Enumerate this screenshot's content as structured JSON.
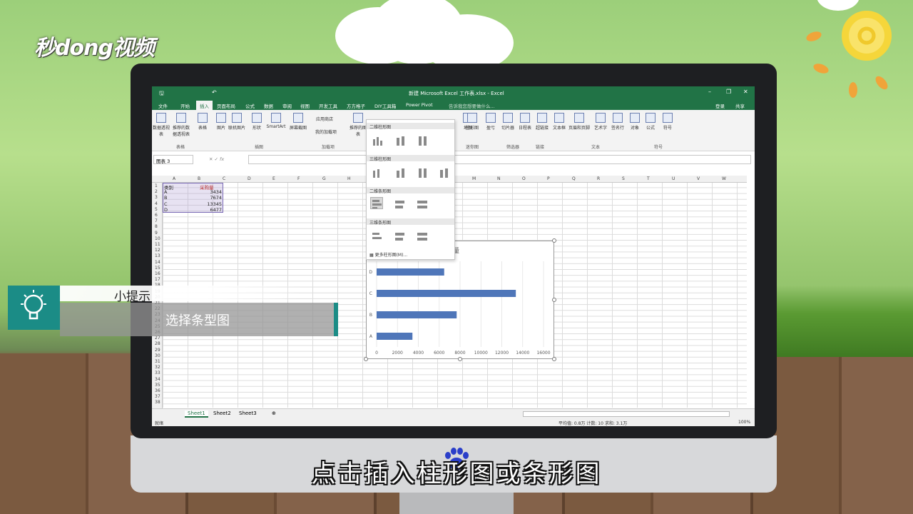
{
  "branding": {
    "logo_text": "秒dong视频"
  },
  "excel": {
    "window_title": "新建 Microsoft Excel 工作表.xlsx - Excel",
    "tabs": [
      "文件",
      "开始",
      "插入",
      "页面布局",
      "公式",
      "数据",
      "审阅",
      "视图",
      "开发工具",
      "方方格子",
      "DIY工具箱",
      "Power Pivot"
    ],
    "active_tab": "插入",
    "tell_me": "告诉我您想要做什么...",
    "login": "登录",
    "share": "共享",
    "ribbon": {
      "buttons": [
        "数据透视表",
        "推荐的数据透视表",
        "表格",
        "图片",
        "联机图片",
        "形状",
        "SmartArt",
        "屏幕截图",
        "应用商店",
        "我的加载项",
        "推荐的图表",
        "地图",
        "柱形图",
        "盈亏",
        "切片器",
        "日程表",
        "超链接",
        "文本框",
        "页眉和页脚",
        "艺术字",
        "签名行",
        "对象",
        "公式",
        "符号"
      ],
      "groups": [
        "表格",
        "插图",
        "加载项",
        "迷你图",
        "筛选器",
        "链接",
        "文本",
        "符号"
      ]
    },
    "name_box": "图表 3",
    "columns": [
      "A",
      "B",
      "C",
      "D",
      "E",
      "F",
      "G",
      "H",
      "I",
      "J",
      "K",
      "L",
      "M",
      "N",
      "O",
      "P",
      "Q",
      "R",
      "S",
      "T",
      "U",
      "V",
      "W"
    ],
    "rows": [
      "1",
      "2",
      "3",
      "4",
      "5",
      "6",
      "7",
      "8",
      "9",
      "10",
      "11",
      "12",
      "13",
      "14",
      "15",
      "16",
      "17",
      "18",
      "19",
      "20",
      "21",
      "22",
      "23",
      "24",
      "25",
      "26",
      "27",
      "28",
      "29",
      "30",
      "31",
      "32",
      "33",
      "34",
      "35",
      "36",
      "37",
      "38"
    ],
    "cells": {
      "header": [
        "类别",
        "采购量"
      ],
      "data": [
        [
          "A",
          "3434"
        ],
        [
          "B",
          "7674"
        ],
        [
          "C",
          "13345"
        ],
        [
          "D",
          "6477"
        ]
      ]
    },
    "sheets": [
      "Sheet1",
      "Sheet2",
      "Sheet3"
    ],
    "active_sheet": "Sheet1",
    "status_ready": "就绪",
    "status_stats": "平均值: 0.8万   计数: 10   求和: 3.1万",
    "zoom": "100%"
  },
  "dropdown": {
    "sections": [
      "二维柱形图",
      "三维柱形图",
      "二维条形图",
      "三维条形图"
    ],
    "more": "更多柱形图(M)..."
  },
  "chart_data": {
    "type": "bar",
    "orientation": "horizontal",
    "title": "采购量",
    "title_visible": "购量",
    "categories": [
      "A",
      "B",
      "C",
      "D"
    ],
    "values": [
      3434,
      7674,
      13345,
      6477
    ],
    "xlim": [
      0,
      16000
    ],
    "ticks": [
      "0",
      "2000",
      "4000",
      "6000",
      "8000",
      "10000",
      "12000",
      "14000",
      "16000"
    ],
    "color": "#4f76b9",
    "grid": true
  },
  "tip": {
    "title": "小提示",
    "text": "选择条型图"
  },
  "subtitle": "点击插入柱形图或条形图"
}
